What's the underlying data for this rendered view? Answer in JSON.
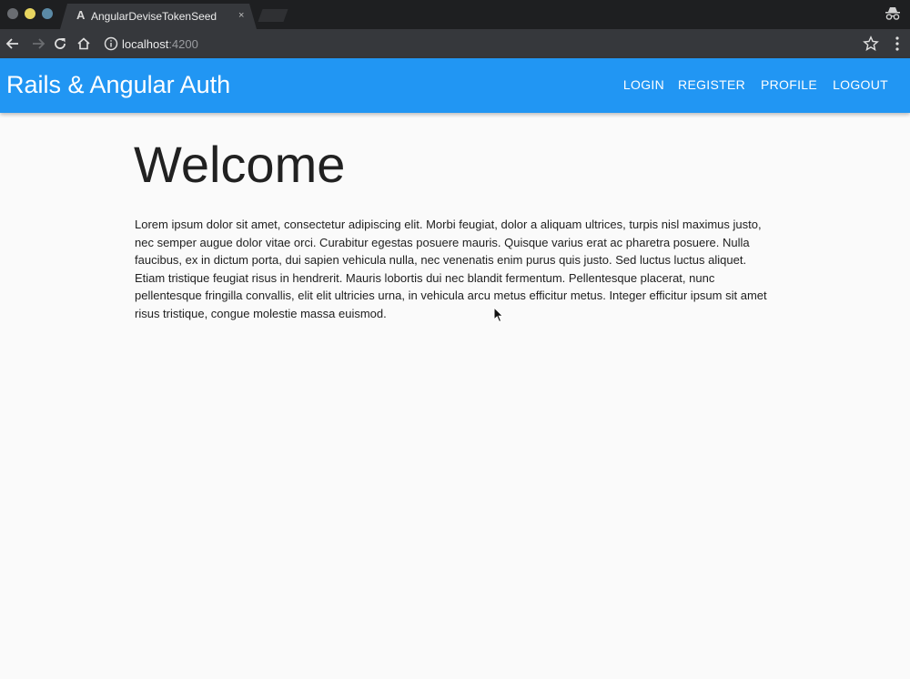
{
  "browser": {
    "tab_title": "AngularDeviseTokenSeed",
    "tab_favicon": "A",
    "tab_close": "×",
    "url_host": "localhost",
    "url_port": ":4200",
    "icons": [
      "back-arrow-icon",
      "forward-arrow-icon",
      "reload-icon",
      "home-icon",
      "info-icon",
      "bookmark-star-icon",
      "menu-kebab-icon",
      "incognito-icon"
    ]
  },
  "header": {
    "title": "Rails & Angular Auth",
    "nav": {
      "login": "LOGIN",
      "register": "REGISTER",
      "profile": "PROFILE",
      "logout": "LOGOUT"
    },
    "color": "#2196f3"
  },
  "main": {
    "heading": "Welcome",
    "body": "Lorem ipsum dolor sit amet, consectetur adipiscing elit. Morbi feugiat, dolor a aliquam ultrices, turpis nisl maximus justo, nec semper augue dolor vitae orci. Curabitur egestas posuere mauris. Quisque varius erat ac pharetra posuere. Nulla faucibus, ex in dictum porta, dui sapien vehicula nulla, nec venenatis enim purus quis justo. Sed luctus luctus aliquet. Etiam tristique feugiat risus in hendrerit. Mauris lobortis dui nec blandit fermentum. Pellentesque placerat, nunc pellentesque fringilla convallis, elit elit ultricies urna, in vehicula arcu metus efficitur metus. Integer efficitur ipsum sit amet risus tristique, congue molestie massa euismod."
  }
}
